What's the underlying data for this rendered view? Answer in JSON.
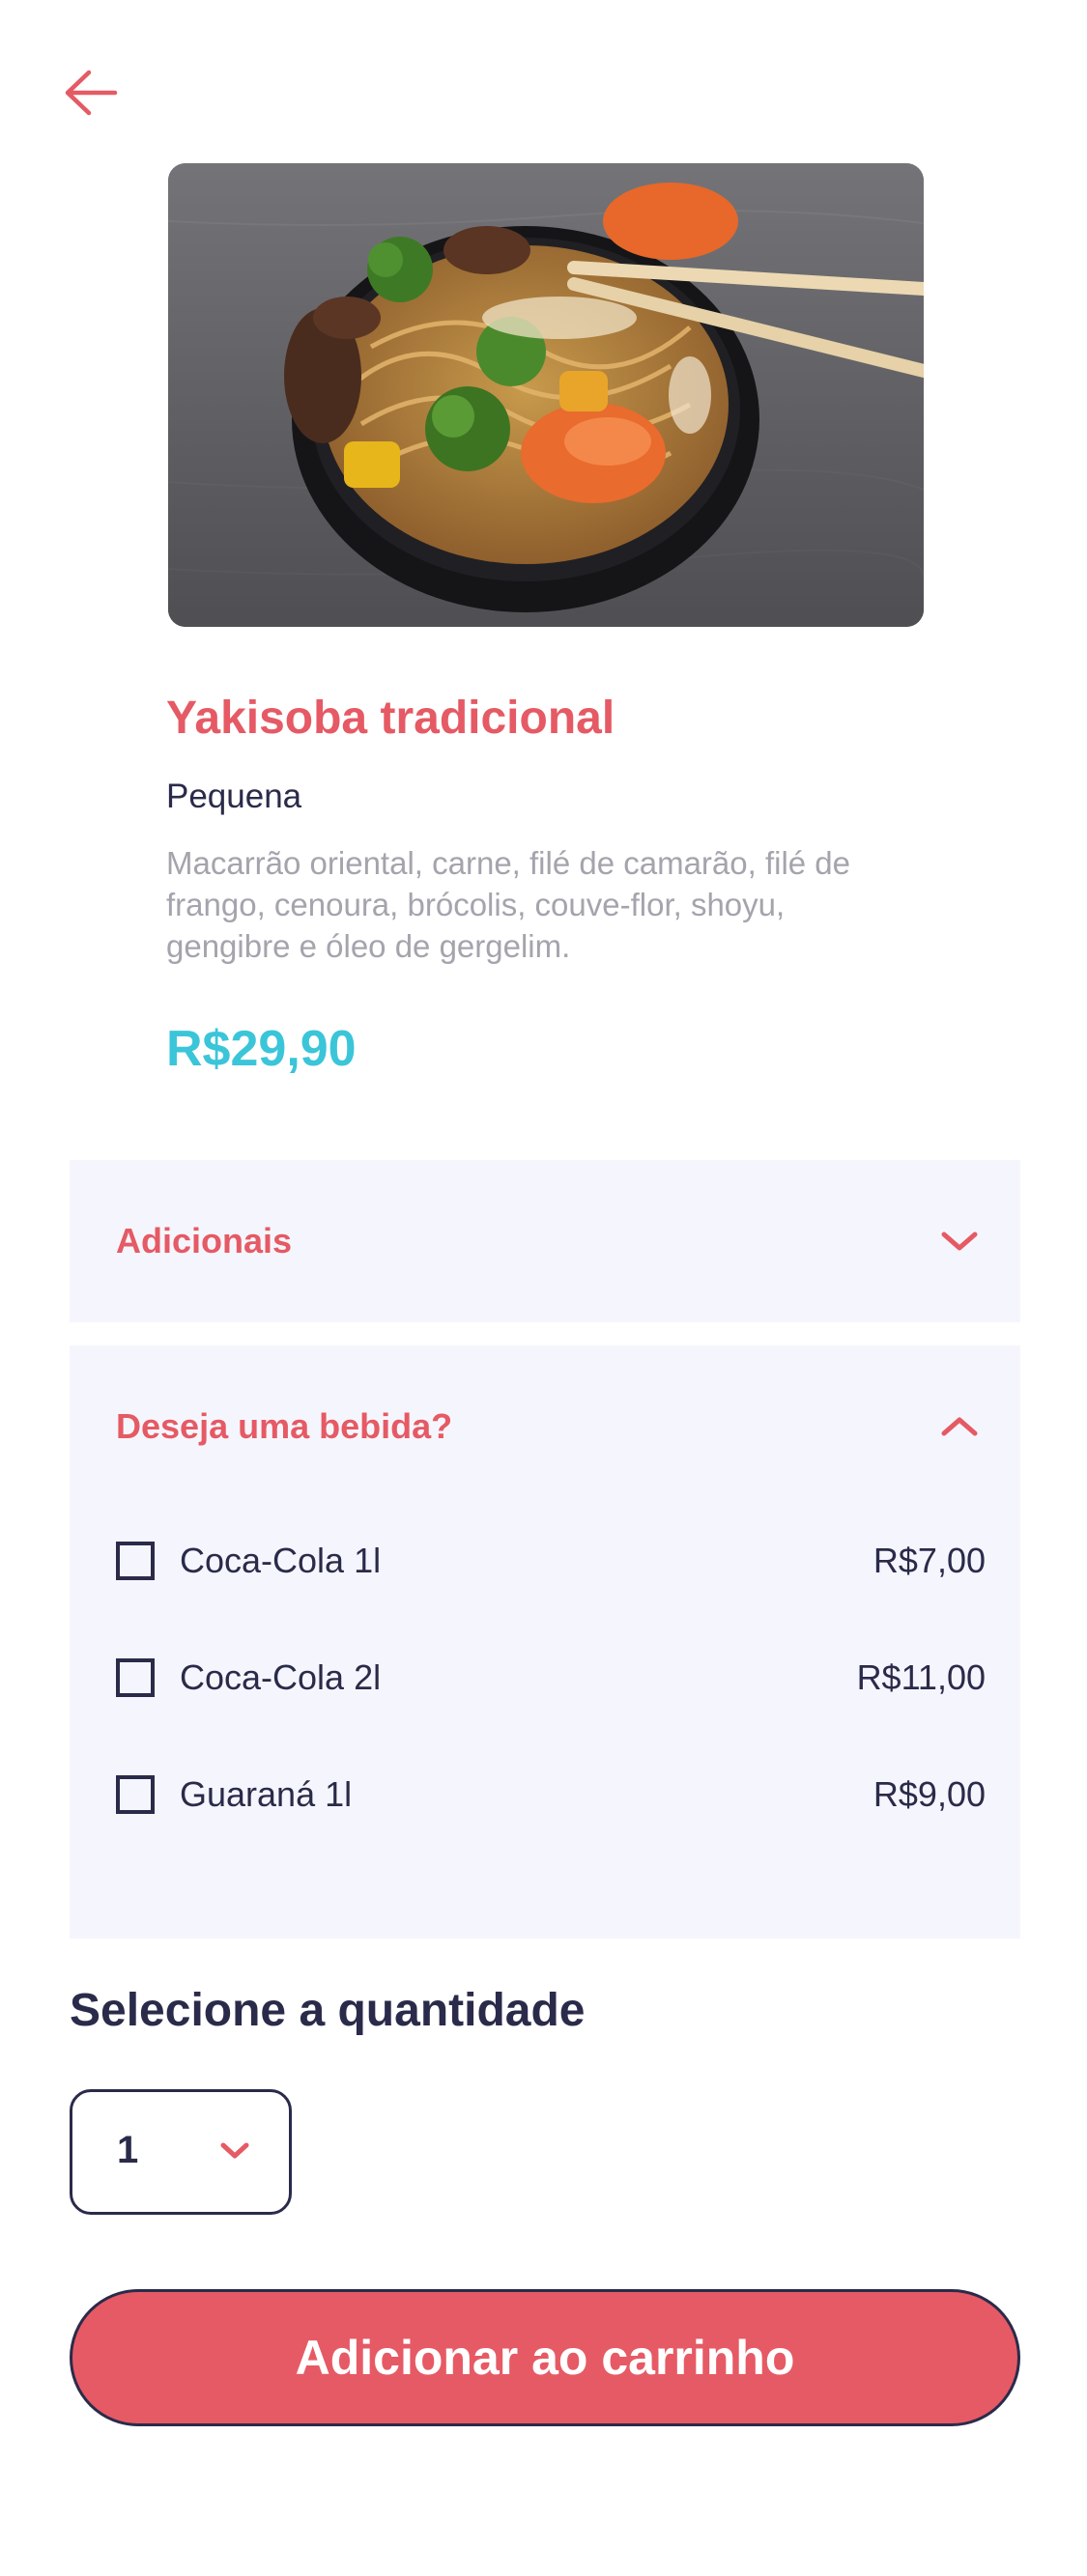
{
  "header": {
    "back_icon": "arrow-left-icon"
  },
  "product": {
    "image_alt": "Yakisoba tradicional",
    "name": "Yakisoba tradicional",
    "size": "Pequena",
    "description": "Macarrão oriental, carne, filé de camarão, filé de frango, cenoura, brócolis, couve-flor, shoyu, gengibre e óleo de gergelim.",
    "price": "R$29,90"
  },
  "sections": [
    {
      "title": "Adicionais",
      "expanded": false,
      "icon": "chevron-down-icon"
    },
    {
      "title": "Deseja uma bebida?",
      "expanded": true,
      "icon": "chevron-up-icon",
      "options": [
        {
          "label": "Coca-Cola 1l",
          "price": "R$7,00",
          "checked": false
        },
        {
          "label": "Coca-Cola 2l",
          "price": "R$11,00",
          "checked": false
        },
        {
          "label": "Guaraná 1l",
          "price": "R$9,00",
          "checked": false
        }
      ]
    }
  ],
  "quantity": {
    "heading": "Selecione a quantidade",
    "selected": "1",
    "icon": "chevron-down-icon"
  },
  "cta": {
    "label": "Adicionar ao carrinho"
  },
  "colors": {
    "accent": "#e55a64",
    "price": "#3bc5d9",
    "text": "#2a2b4a",
    "muted": "#a4a4ad",
    "panel": "#f5f6fd",
    "button": "#e65a65"
  }
}
